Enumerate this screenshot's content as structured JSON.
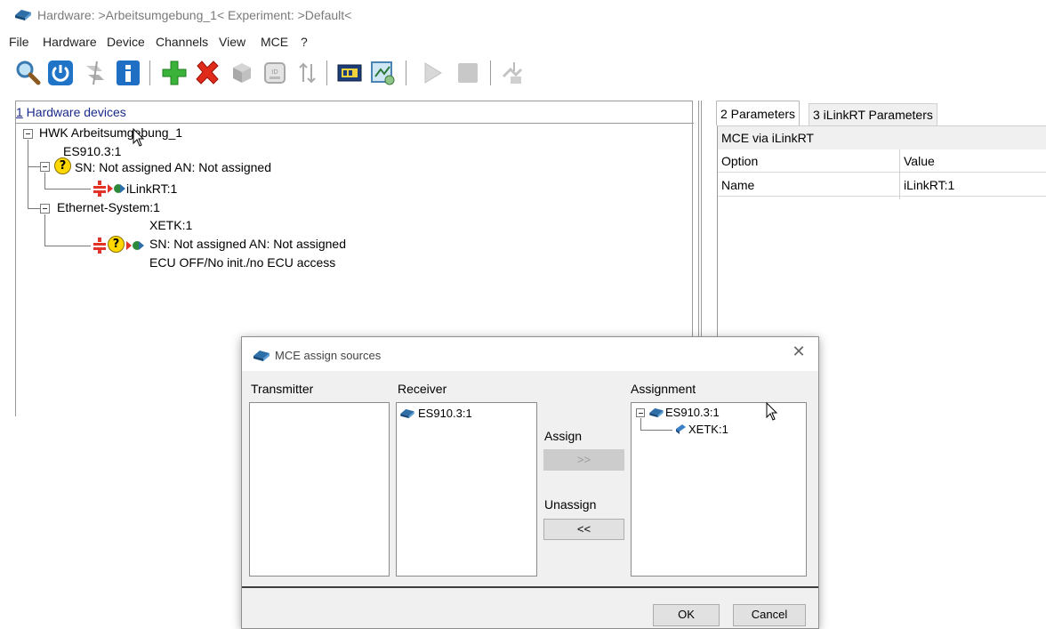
{
  "window": {
    "title": "Hardware: >Arbeitsumgebung_1<   Experiment: >Default<"
  },
  "menu": [
    "File",
    "Hardware",
    "Device",
    "Channels",
    "View",
    "MCE",
    "?"
  ],
  "toolbar": {
    "icons": [
      "search-icon",
      "power-icon",
      "disconnect-icon",
      "info-icon",
      "add-icon",
      "delete-icon",
      "cube-icon",
      "id-card-icon",
      "sort-icon",
      "ecu-icon",
      "network-icon",
      "play-icon",
      "stop-icon",
      "calibration-icon"
    ]
  },
  "hardware_panel": {
    "header_num": "1",
    "header_rest": " Hardware devices",
    "tree": {
      "root": "HWK Arbeitsumgebung_1",
      "es910": "ES910.3:1",
      "es910_sn": "SN: Not assigned AN: Not assigned",
      "ilink": "iLinkRT:1",
      "ethernet": "Ethernet-System:1",
      "xetk": "XETK:1",
      "xetk_sn": "SN: Not assigned AN: Not assigned",
      "xetk_status": "ECU OFF/No init./no ECU access"
    }
  },
  "param_panel": {
    "tabs": [
      "2 Parameters",
      "3 iLinkRT Parameters"
    ],
    "section_title": "MCE via iLinkRT",
    "columns": [
      "Option",
      "Value"
    ],
    "rows": [
      {
        "option": "Name",
        "value": "iLinkRT:1"
      }
    ]
  },
  "dialog": {
    "title": "MCE assign sources",
    "transmitter_label": "Transmitter",
    "receiver_label": "Receiver",
    "assignment_label": "Assignment",
    "receiver_items": [
      "ES910.3:1"
    ],
    "assignment_root": "ES910.3:1",
    "assignment_child": "XETK:1",
    "assign_label": "Assign",
    "assign_button": ">>",
    "unassign_label": "Unassign",
    "unassign_button": "<<",
    "ok_button": "OK",
    "cancel_button": "Cancel"
  },
  "colors": {
    "link_blue": "#1a2a8a",
    "question_yellow": "#ffd800",
    "dialog_background": "#f0f0f0"
  }
}
